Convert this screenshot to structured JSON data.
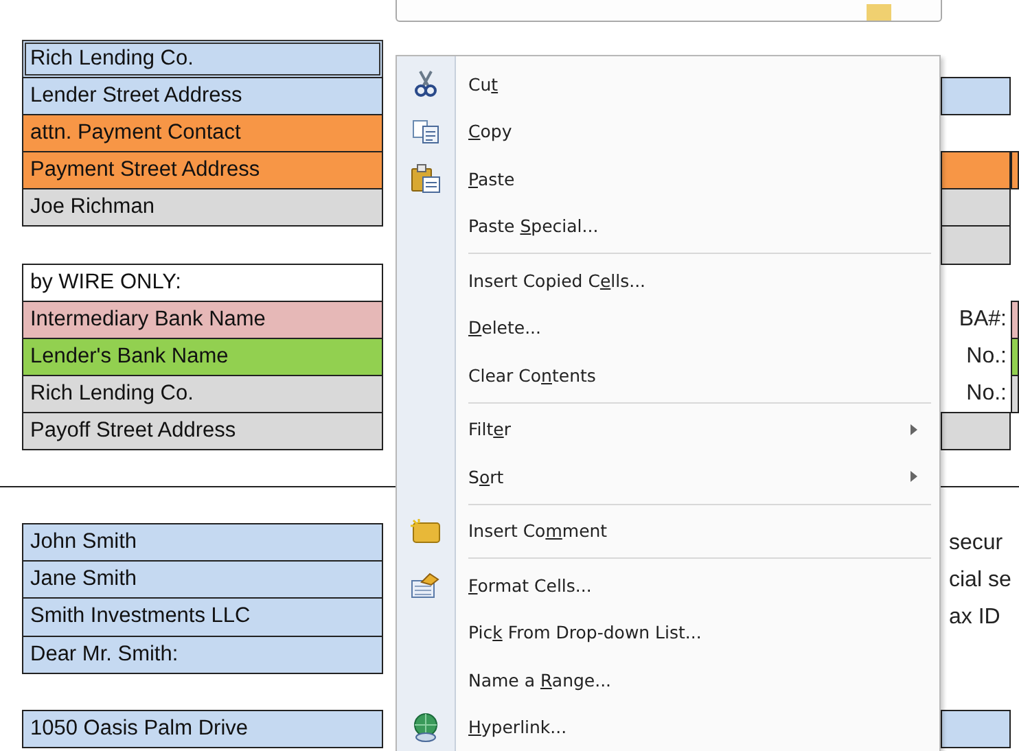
{
  "sheet": {
    "rows": [
      {
        "cell": {
          "text": "Rich Lending Co.",
          "color": "#c5d9f1",
          "selected": true
        }
      },
      {
        "cell": {
          "text": "Lender Street Address",
          "color": "#c5d9f1",
          "selected": false
        },
        "right": {
          "kind": "cell",
          "color": "#c5d9f1"
        }
      },
      {
        "cell": {
          "text": "attn. Payment Contact",
          "color": "#f79646",
          "selected": false
        }
      },
      {
        "cell": {
          "text": "Payment Street Address",
          "color": "#f79646",
          "selected": false
        },
        "right": {
          "kind": "wide",
          "color": "#f79646"
        }
      },
      {
        "cell": {
          "text": "Joe Richman",
          "color": "#d9d9d9",
          "selected": false
        },
        "right": {
          "kind": "cell",
          "color": "#d9d9d9"
        }
      },
      {
        "right": {
          "kind": "cell",
          "color": "#d9d9d9"
        }
      },
      {
        "cell": {
          "text": "by WIRE ONLY:",
          "color": "#ffffff",
          "selected": false
        }
      },
      {
        "cell": {
          "text": "Intermediary Bank Name",
          "color": "#e6b8b7",
          "selected": false
        },
        "right": {
          "kind": "label",
          "text": "BA#:",
          "color": "#e6b8b7"
        }
      },
      {
        "cell": {
          "text": "Lender's Bank Name",
          "color": "#92d050",
          "selected": false
        },
        "right": {
          "kind": "label",
          "text": "No.:",
          "color": "#92d050"
        }
      },
      {
        "cell": {
          "text": "Rich Lending Co.",
          "color": "#d9d9d9",
          "selected": false
        },
        "right": {
          "kind": "label",
          "text": "No.:",
          "color": "#d9d9d9"
        }
      },
      {
        "cell": {
          "text": "Payoff Street Address",
          "color": "#d9d9d9",
          "selected": false
        },
        "right": {
          "kind": "cell",
          "color": "#d9d9d9"
        }
      },
      {},
      {
        "divider_above": true
      },
      {
        "cell": {
          "text": "John Smith",
          "color": "#c5d9f1",
          "selected": false
        },
        "right": {
          "kind": "text",
          "text": "secur"
        }
      },
      {
        "cell": {
          "text": "Jane Smith",
          "color": "#c5d9f1",
          "selected": false
        },
        "right": {
          "kind": "text",
          "text": "cial se"
        }
      },
      {
        "cell": {
          "text": "Smith Investments LLC",
          "color": "#c5d9f1",
          "selected": false
        },
        "right": {
          "kind": "text",
          "text": "ax ID"
        }
      },
      {
        "cell": {
          "text": "Dear Mr. Smith:",
          "color": "#c5d9f1",
          "selected": false
        }
      },
      {},
      {
        "cell": {
          "text": "1050 Oasis Palm Drive",
          "color": "#c5d9f1",
          "selected": false
        },
        "right": {
          "kind": "cell",
          "color": "#c5d9f1"
        }
      }
    ]
  },
  "context_menu": {
    "groups": [
      [
        {
          "pre": "Cu",
          "key": "t"
        },
        {
          "key": "C",
          "post": "opy"
        },
        {
          "key": "P",
          "post": "aste"
        },
        {
          "pre": "Paste ",
          "key": "S",
          "post": "pecial..."
        }
      ],
      [
        {
          "pre": "Insert Copied C",
          "key": "e",
          "post": "lls..."
        },
        {
          "key": "D",
          "post": "elete..."
        },
        {
          "pre": "Clear Co",
          "key": "n",
          "post": "tents"
        }
      ],
      [
        {
          "pre": "Filt",
          "key": "e",
          "post": "r",
          "submenu": true
        },
        {
          "pre": "S",
          "key": "o",
          "post": "rt",
          "submenu": true
        }
      ],
      [
        {
          "pre": "Insert Co",
          "key": "m",
          "post": "ment"
        }
      ],
      [
        {
          "key": "F",
          "post": "ormat Cells..."
        },
        {
          "pre": "Pic",
          "key": "k",
          "post": " From Drop-down List..."
        },
        {
          "pre": "Name a ",
          "key": "R",
          "post": "ange..."
        },
        {
          "key": "H",
          "post": "yperlink..."
        }
      ]
    ]
  }
}
